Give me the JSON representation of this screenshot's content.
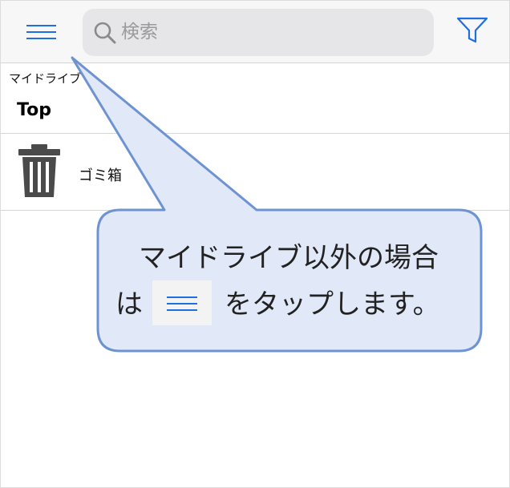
{
  "toolbar": {
    "menu_icon": "hamburger-icon",
    "search_placeholder": "検索",
    "search_icon": "search-icon",
    "filter_icon": "filter-icon",
    "accent_color": "#1f6fe0"
  },
  "location": {
    "breadcrumb": "マイドライブ",
    "title": "Top"
  },
  "items": [
    {
      "label": "ゴミ箱",
      "icon": "trash-icon"
    }
  ],
  "callout": {
    "line1": "マイドライブ以外の場合",
    "line2_start": "は",
    "line2_end": "をタップします。",
    "inline_icon": "hamburger-icon",
    "fill_color": "#e1e8f7",
    "border_color": "#6e93d2"
  }
}
